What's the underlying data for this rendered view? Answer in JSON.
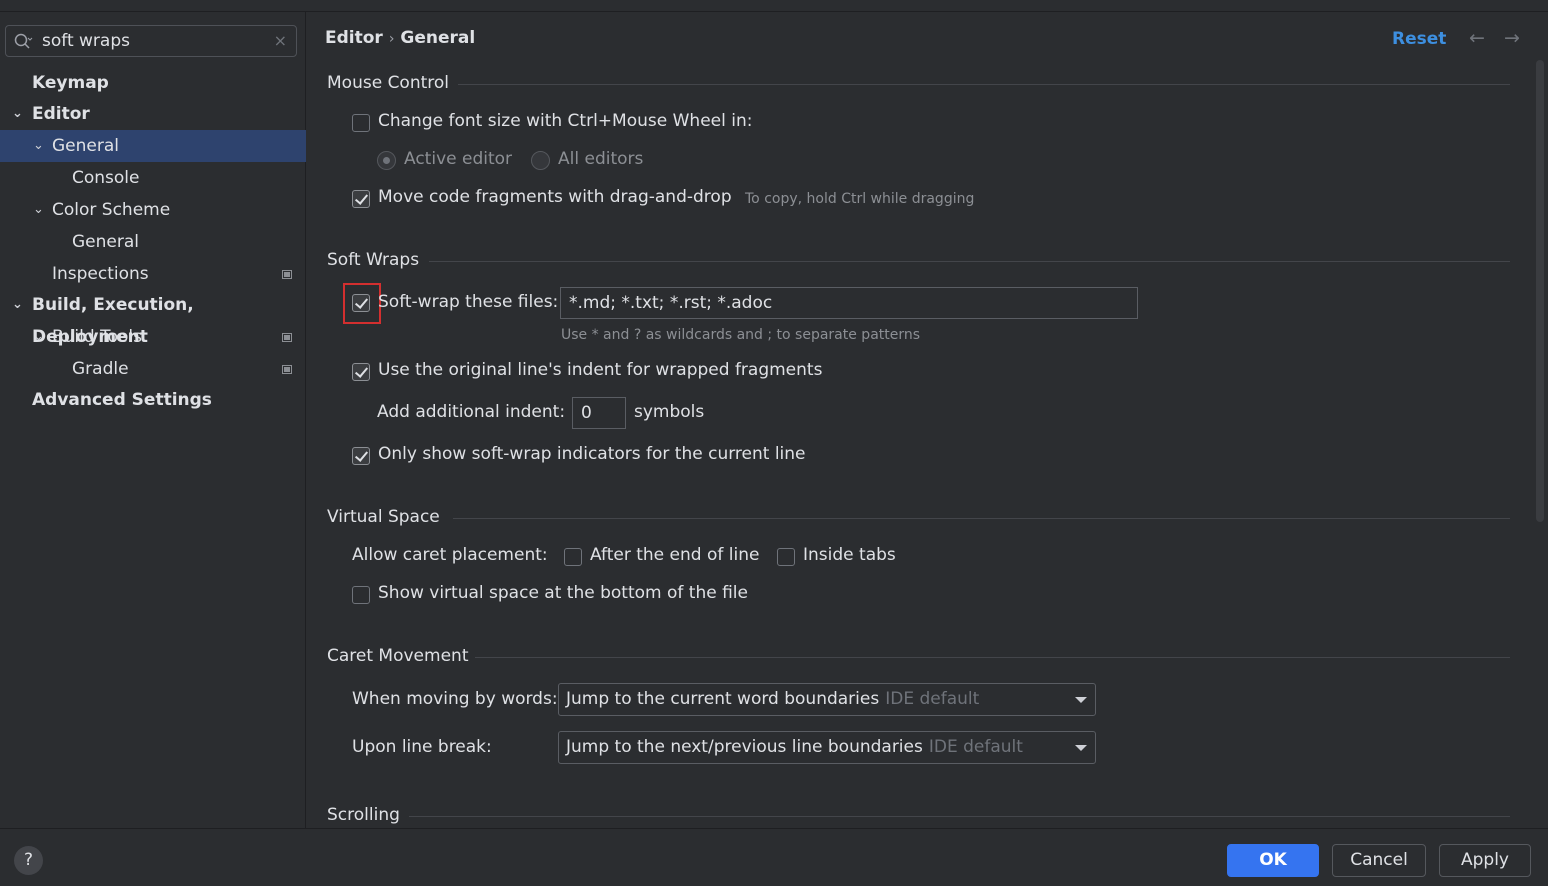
{
  "search": {
    "value": "soft wraps",
    "clear_glyph": "×"
  },
  "tree": [
    {
      "label": "Keymap",
      "chevron": ""
    },
    {
      "label": "Editor",
      "chevron": "⌄"
    },
    {
      "label": "General",
      "chevron": "⌄"
    },
    {
      "label": "Console",
      "chevron": ""
    },
    {
      "label": "Color Scheme",
      "chevron": "⌄"
    },
    {
      "label": "General",
      "chevron": ""
    },
    {
      "label": "Inspections",
      "chevron": ""
    },
    {
      "label": "Build, Execution, Deployment",
      "chevron": "⌄"
    },
    {
      "label": "Build Tools",
      "chevron": "⌄"
    },
    {
      "label": "Gradle",
      "chevron": ""
    },
    {
      "label": "Advanced Settings",
      "chevron": ""
    }
  ],
  "breadcrumb": {
    "part1": "Editor",
    "separator": "›",
    "part2": "General"
  },
  "header": {
    "reset_label": "Reset",
    "back_arrow": "←",
    "forward_arrow": "→"
  },
  "mouse_control": {
    "title": "Mouse Control",
    "font_size_label": "Change font size with Ctrl+Mouse Wheel in:",
    "radio_active": "Active editor",
    "radio_all": "All editors",
    "drag_drop_label": "Move code fragments with drag-and-drop",
    "drag_drop_hint": "To copy, hold Ctrl while dragging"
  },
  "soft_wraps": {
    "title": "Soft Wraps",
    "files_label": "Soft-wrap these files:",
    "files_value": "*.md; *.txt; *.rst; *.adoc",
    "files_hint": "Use * and ? as wildcards and ; to separate patterns",
    "indent_label": "Use the original line's indent for wrapped fragments",
    "additional_indent_label": "Add additional indent:",
    "additional_indent_value": "0",
    "symbols_label": "symbols",
    "indicators_label": "Only show soft-wrap indicators for the current line"
  },
  "virtual_space": {
    "title": "Virtual Space",
    "caret_label": "Allow caret placement:",
    "after_end_label": "After the end of line",
    "inside_tabs_label": "Inside tabs",
    "show_bottom_label": "Show virtual space at the bottom of the file"
  },
  "caret_movement": {
    "title": "Caret Movement",
    "words_label": "When moving by words:",
    "words_value": "Jump to the current word boundaries",
    "words_default": "IDE default",
    "line_break_label": "Upon line break:",
    "line_break_value": "Jump to the next/previous line boundaries",
    "line_break_default": "IDE default"
  },
  "scrolling": {
    "title": "Scrolling"
  },
  "footer": {
    "help": "?",
    "ok": "OK",
    "cancel": "Cancel",
    "apply": "Apply"
  },
  "colors": {
    "accent": "#3574f0",
    "link": "#3d8fe0",
    "selection": "#2e436e",
    "highlight_box": "#d32f2f"
  }
}
